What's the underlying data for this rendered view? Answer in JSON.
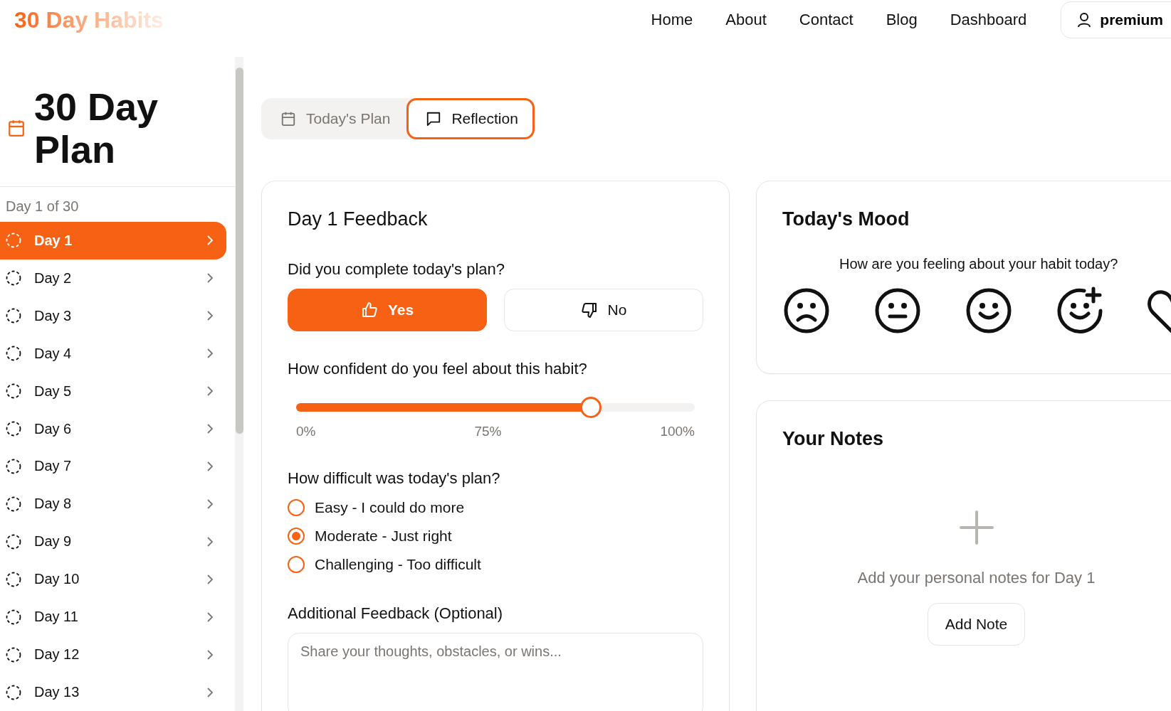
{
  "header": {
    "logo": "30 Day Habits",
    "nav": [
      "Home",
      "About",
      "Contact",
      "Blog",
      "Dashboard"
    ],
    "account": "premium"
  },
  "sidebar": {
    "title": "30 Day Plan",
    "progress": "Day 1 of 30",
    "items": [
      {
        "label": "Day 1",
        "selected": true
      },
      {
        "label": "Day 2",
        "selected": false
      },
      {
        "label": "Day 3",
        "selected": false
      },
      {
        "label": "Day 4",
        "selected": false
      },
      {
        "label": "Day 5",
        "selected": false
      },
      {
        "label": "Day 6",
        "selected": false
      },
      {
        "label": "Day 7",
        "selected": false
      },
      {
        "label": "Day 8",
        "selected": false
      },
      {
        "label": "Day 9",
        "selected": false
      },
      {
        "label": "Day 10",
        "selected": false
      },
      {
        "label": "Day 11",
        "selected": false
      },
      {
        "label": "Day 12",
        "selected": false
      },
      {
        "label": "Day 13",
        "selected": false
      }
    ]
  },
  "tabs": [
    {
      "label": "Today's Plan",
      "kind": "calendar",
      "selected": false
    },
    {
      "label": "Reflection",
      "kind": "message",
      "selected": true
    }
  ],
  "feedback": {
    "title": "Day 1 Feedback",
    "completion": {
      "question": "Did you complete today's plan?",
      "options": [
        {
          "label": "Yes",
          "kind": "up",
          "selected": true
        },
        {
          "label": "No",
          "kind": "down",
          "selected": false
        }
      ]
    },
    "confidence": {
      "question": "How confident do you feel about this habit?",
      "level": 0.74,
      "ticks": [
        "0%",
        "75%",
        "100%"
      ]
    },
    "difficulty": {
      "question": "How difficult was today's plan?",
      "options": [
        {
          "label": "Easy - I could do more",
          "selected": false
        },
        {
          "label": "Moderate - Just right",
          "selected": true
        },
        {
          "label": "Challenging - Too difficult",
          "selected": false
        }
      ]
    },
    "additional": {
      "label": "Additional Feedback (Optional)",
      "placeholder": "Share your thoughts, obstacles, or wins..."
    }
  },
  "mood": {
    "title": "Today's Mood",
    "prompt": "How are you feeling about your habit today?",
    "options": [
      {
        "kind": "sad"
      },
      {
        "kind": "neutral"
      },
      {
        "kind": "happy"
      },
      {
        "kind": "happy-plus"
      },
      {
        "kind": "heart"
      }
    ]
  },
  "notes": {
    "title": "Your Notes",
    "empty": "Add your personal notes for Day 1",
    "button": "Add Note"
  }
}
